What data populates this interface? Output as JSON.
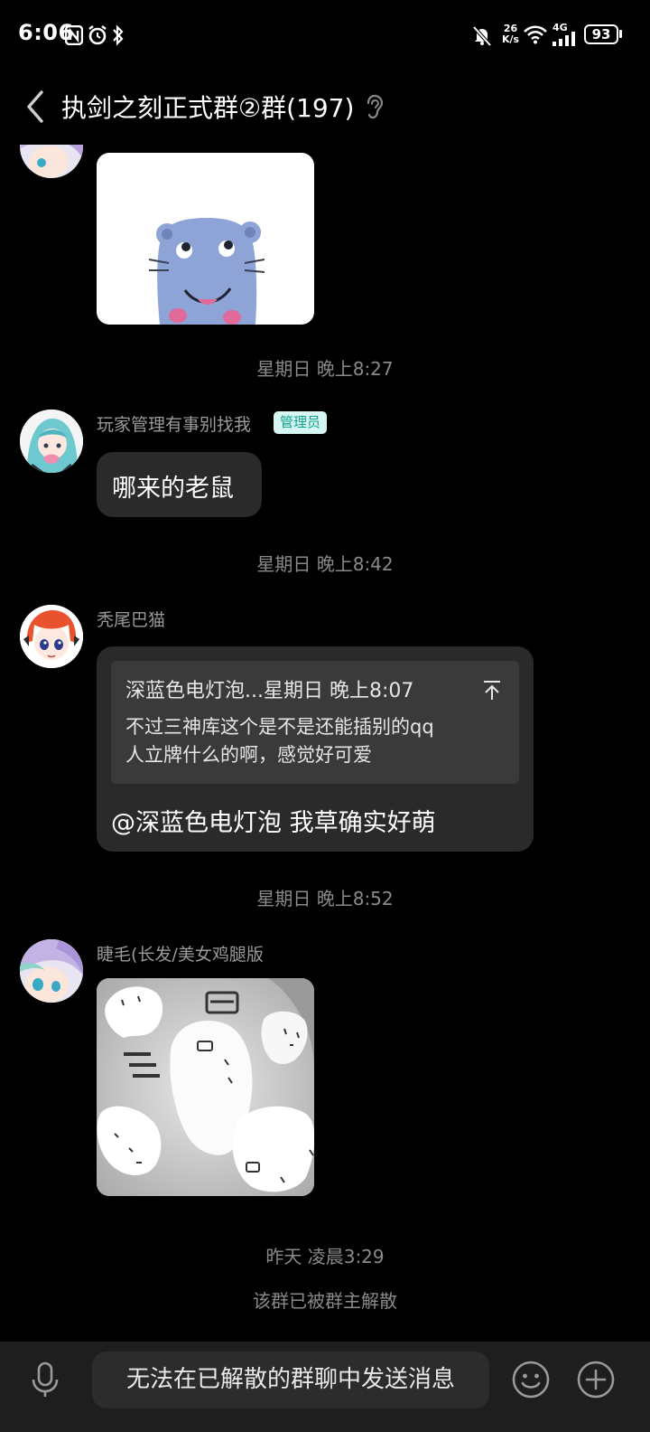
{
  "status_bar": {
    "time": "6:06",
    "net_speed_value": "26",
    "net_speed_unit": "K/s",
    "network_type": "4G",
    "battery": "93"
  },
  "header": {
    "title": "执剑之刻正式群②群(197)"
  },
  "messages": {
    "ts1": "星期日 晚上8:27",
    "msg1_sender": "玩家管理有事别找我",
    "msg1_badge": "管理员",
    "msg1_text": "哪来的老鼠",
    "ts2": "星期日 晚上8:42",
    "msg2_sender": "秃尾巴猫",
    "msg2_quote_source": "深蓝色电灯泡...星期日 晚上8:07",
    "msg2_quote_line1": "不过三神库这个是不是还能插别的qq",
    "msg2_quote_line2": "人立牌什么的啊，感觉好可爱",
    "msg2_text": "@深蓝色电灯泡 我草确实好萌",
    "ts3": "星期日 晚上8:52",
    "msg3_sender": "睫毛(长发/美女鸡腿版",
    "ts4": "昨天 凌晨3:29",
    "system_notice": "该群已被群主解散"
  },
  "bottom_bar": {
    "disabled_input_text": "无法在已解散的群聊中发送消息"
  },
  "icons": {
    "back": "chevron-left-icon",
    "ear": "ear-icon",
    "mic": "microphone-icon",
    "emoji": "emoji-icon",
    "plus": "plus-circle-icon"
  },
  "colors": {
    "background": "#000000",
    "bubble": "#2a2a2a",
    "badge_bg": "#d6f7f1",
    "badge_text": "#10a08c",
    "timestamp": "#8a8a8a"
  }
}
